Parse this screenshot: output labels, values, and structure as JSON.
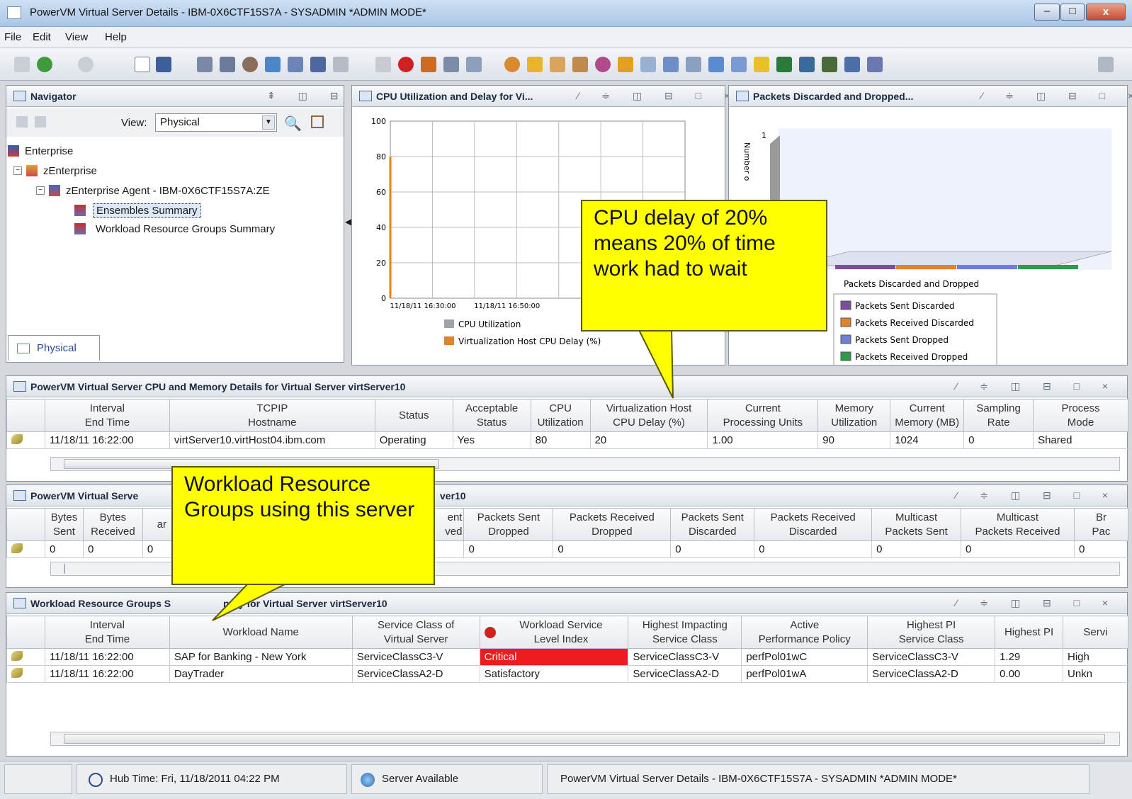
{
  "window": {
    "title": "PowerVM Virtual Server Details - IBM-0X6CTF15S7A - SYSADMIN   *ADMIN MODE*",
    "minimize": "–",
    "maximize": "□",
    "close": "x"
  },
  "menu": [
    "File",
    "Edit",
    "View",
    "Help"
  ],
  "navigator": {
    "title": "Navigator",
    "view_label": "View:",
    "view_value": "Physical",
    "tree": [
      "Enterprise",
      "zEnterprise",
      "zEnterprise Agent - IBM-0X6CTF15S7A:ZE",
      "Ensembles Summary",
      "Workload Resource Groups Summary"
    ],
    "tab": "Physical"
  },
  "cpu_chart": {
    "title": "CPU Utilization and Delay for Vi...",
    "legend": [
      "CPU Utilization",
      "Virtualization Host CPU Delay (%)"
    ],
    "colors": [
      "#9ea4aa",
      "#e0832b"
    ],
    "xticks": [
      "11/18/11 16:30:00",
      "11/18/11 16:50:00"
    ],
    "yticks": [
      "100",
      "80",
      "60",
      "40",
      "20",
      "0"
    ]
  },
  "packets_chart": {
    "title": "Packets Discarded and Dropped...",
    "axis_label": "Number o",
    "ytick": "1",
    "legend_title": "Packets Discarded and Dropped",
    "legend": [
      "Packets Sent Discarded",
      "Packets Received Discarded",
      "Packets Sent Dropped",
      "Packets Received Dropped"
    ],
    "colors": [
      "#7b4d9a",
      "#e0832b",
      "#6d7fd6",
      "#2e9a4a"
    ]
  },
  "cpu_table": {
    "title": "PowerVM Virtual Server CPU and Memory Details for Virtual Server virtServer10",
    "headers": [
      "",
      "Interval\nEnd Time",
      "TCPIP\nHostname",
      "Status",
      "Acceptable\nStatus",
      "CPU\nUtilization",
      "Virtualization Host\nCPU Delay (%)",
      "Current\nProcessing Units",
      "Memory\nUtilization",
      "Current\nMemory (MB)",
      "Sampling\nRate",
      "Process\nMode"
    ],
    "rows": [
      [
        "",
        "11/18/11 16:22:00",
        "virtServer10.virtHost04.ibm.com",
        "Operating",
        "Yes",
        "80",
        "20",
        "1.00",
        "90",
        "1024",
        "0",
        "Shared"
      ]
    ]
  },
  "net_table": {
    "title": "PowerVM Virtual Server Network Details for Virtual Server virtServer10",
    "title_left": "PowerVM Virtual Serve",
    "title_right": "ver10",
    "headers": [
      "",
      "Bytes\nSent",
      "Bytes\nReceived",
      "",
      "",
      "Packets Sent\nDropped",
      "Packets Received\nDropped",
      "Packets Sent\nDiscarded",
      "Packets Received\nDiscarded",
      "Multicast\nPackets Sent",
      "Multicast\nPackets Received",
      "Br\nPac"
    ],
    "header_frag_a": "ar",
    "header_frag_b": "ent\nved",
    "rows": [
      [
        "",
        "0",
        "0",
        "0",
        "",
        "0",
        "0",
        "0",
        "0",
        "0",
        "0",
        "0"
      ]
    ]
  },
  "wrg_table": {
    "title": "Workload Resource Groups Summary for Virtual Server virtServer10",
    "title_left": "Workload Resource Groups S",
    "title_right": "nary for Virtual Server virtServer10",
    "headers": [
      "",
      "Interval\nEnd Time",
      "Workload Name",
      "Service Class of\nVirtual Server",
      "Workload Service\nLevel Index",
      "Highest Impacting\nService Class",
      "Active\nPerformance Policy",
      "Highest PI\nService Class",
      "Highest PI",
      "Servi"
    ],
    "rows": [
      [
        "",
        "11/18/11 16:22:00",
        "SAP for Banking - New York",
        "ServiceClassC3-V",
        "Critical",
        "ServiceClassC3-V",
        "perfPol01wC",
        "ServiceClassC3-V",
        "1.29",
        "High"
      ],
      [
        "",
        "11/18/11 16:22:00",
        "DayTrader",
        "ServiceClassA2-D",
        "Satisfactory",
        "ServiceClassA2-D",
        "perfPol01wA",
        "ServiceClassA2-D",
        "0.00",
        "Unkn"
      ]
    ],
    "critical_color": "#ee1c1c"
  },
  "callouts": {
    "cpu_delay": "CPU delay of 20% means 20% of time work had to wait",
    "wrg": "Workload Resource Groups using this server"
  },
  "status": {
    "hub_time": "Hub Time: Fri, 11/18/2011 04:22 PM",
    "server": "Server Available",
    "window": "PowerVM Virtual Server Details - IBM-0X6CTF15S7A - SYSADMIN   *ADMIN MODE*"
  },
  "panel_controls": "⁄ ≑ ◫ ⊟ □ ×"
}
